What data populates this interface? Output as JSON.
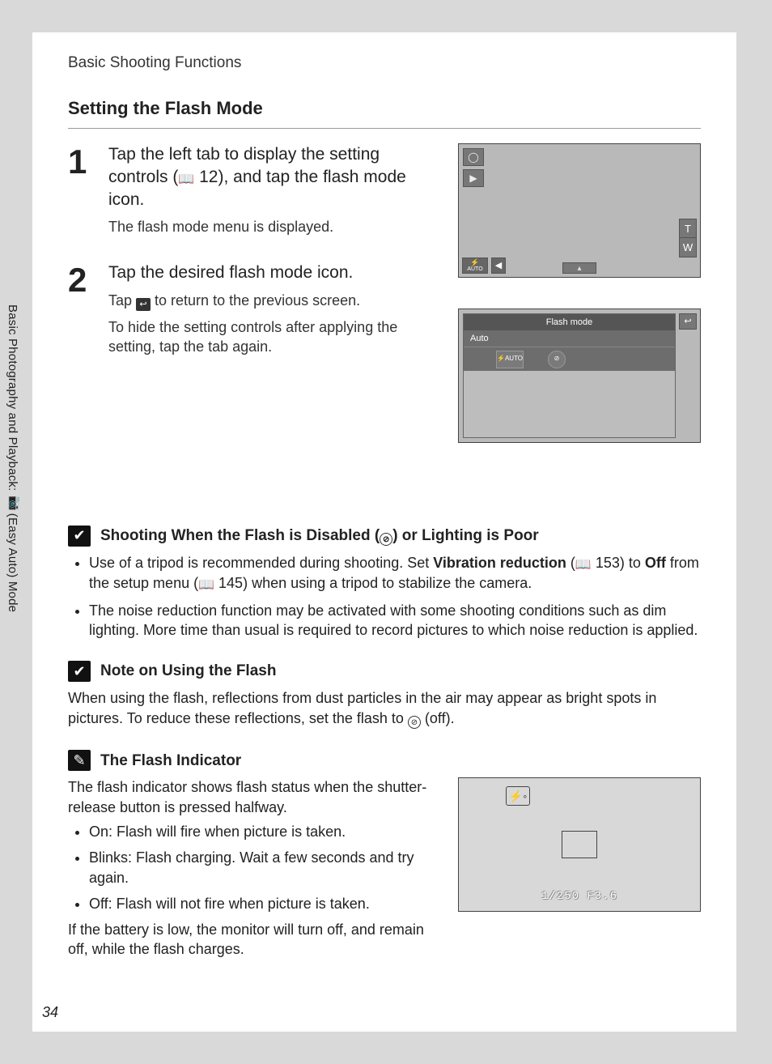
{
  "header": "Basic Shooting Functions",
  "section_title": "Setting the Flash Mode",
  "page_number": "34",
  "side_label_before": "Basic Photography and Playback: ",
  "side_label_after": " (Easy Auto) Mode",
  "steps": [
    {
      "num": "1",
      "lead_a": "Tap the left tab to display the setting controls (",
      "lead_ref": "12",
      "lead_b": "), and tap the flash mode icon.",
      "detail": "The flash mode menu is displayed."
    },
    {
      "num": "2",
      "lead": "Tap the desired flash mode icon.",
      "detail1_a": "Tap ",
      "detail1_b": " to return to the previous screen.",
      "detail2": "To hide the setting controls after applying the setting, tap the tab again."
    }
  ],
  "screen1": {
    "auto_label": "AUTO",
    "t_label": "T",
    "w_label": "W"
  },
  "screen2": {
    "title": "Flash mode",
    "selected": "Auto",
    "opt1": "AUTO"
  },
  "note1": {
    "title_a": "Shooting When the Flash is Disabled (",
    "title_b": ") or Lighting is Poor",
    "bullet1_a": "Use of a tripod is recommended during shooting. Set ",
    "bullet1_bold": "Vibration reduction",
    "bullet1_b": " (",
    "bullet1_ref": "153",
    "bullet1_c": ") to ",
    "bullet1_off": "Off",
    "bullet1_d": " from the setup menu (",
    "bullet1_ref2": "145",
    "bullet1_e": ") when using a tripod to stabilize the camera.",
    "bullet2": "The noise reduction function may be activated with some shooting conditions such as dim lighting. More time than usual is required to record pictures to which noise reduction is applied."
  },
  "note2": {
    "title": "Note on Using the Flash",
    "para_a": "When using the flash, reflections from dust particles in the air may appear as bright spots in pictures. To reduce these reflections, set the flash to ",
    "para_b": " (off)."
  },
  "note3": {
    "title": "The Flash Indicator",
    "lead": "The flash indicator shows flash status when the shutter-release button is pressed halfway.",
    "bullets": [
      "On: Flash will fire when picture is taken.",
      "Blinks: Flash charging. Wait a few seconds and try again.",
      "Off: Flash will not fire when picture is taken."
    ],
    "tail": "If the battery is low, the monitor will turn off, and remain off, while the flash charges.",
    "exposure": "1/250   F3.6"
  }
}
